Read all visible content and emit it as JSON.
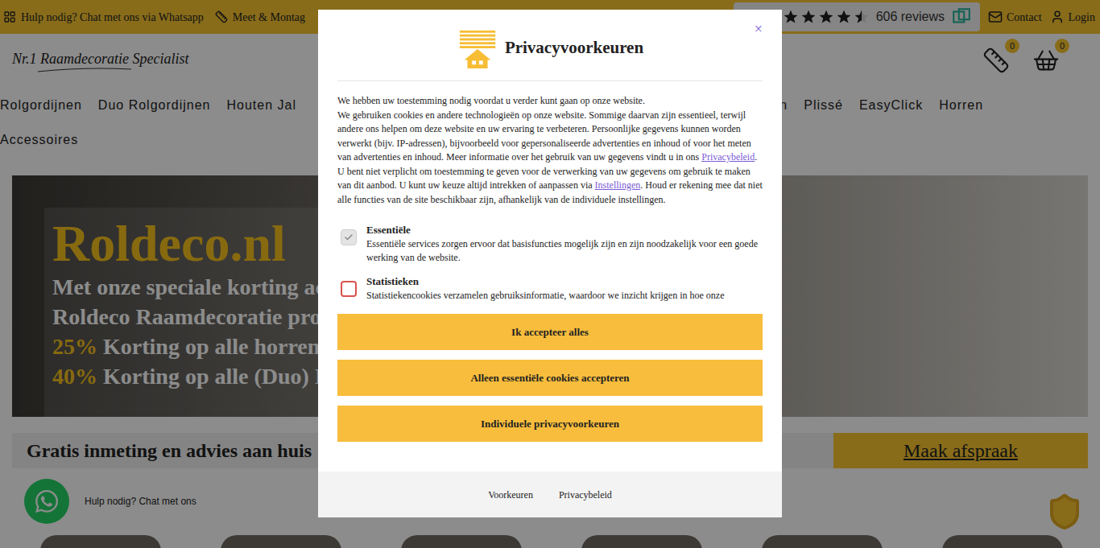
{
  "top_bar": {
    "whatsapp": "Hulp nodig? Chat met ons via Whatsapp",
    "montage": "Meet & Montag",
    "reviews": {
      "stars": 4.5,
      "count": "606 reviews"
    },
    "contact": "Contact",
    "login": "Login"
  },
  "header": {
    "logo": "Nr.1 Raamdecoratie Specialist",
    "compare_count": "0",
    "cart_count": "0"
  },
  "nav": {
    "left": [
      "Rolgordijnen",
      "Duo Rolgordijnen",
      "Houten Jal"
    ],
    "right": [
      "ieën",
      "Plissé",
      "EasyClick",
      "Horren"
    ],
    "second_row": [
      "Accessoires"
    ]
  },
  "hero": {
    "title": "Roldeco.nl",
    "lines": [
      "Met onze speciale korting ac",
      "Roldeco Raamdecoratie prod"
    ],
    "offers": [
      {
        "percent": "25%",
        "text": "Korting op alle horren!"
      },
      {
        "percent": "40%",
        "text": "Korting op alle (Duo) R"
      }
    ]
  },
  "appointment": {
    "text": "Gratis inmeting en advies aan huis",
    "button": "Maak afspraak"
  },
  "whatsapp_widget": {
    "label": "Hulp nodig? Chat met ons"
  },
  "modal": {
    "title": "Privacyvoorkeuren",
    "close": "×",
    "intro": "We hebben uw toestemming nodig voordat u verder kunt gaan op onze website.",
    "body": [
      {
        "text": "We gebruiken cookies en andere technologieën op onze website. Sommige daarvan zijn essentieel, terwijl andere ons helpen om deze website en uw ervaring te verbeteren. Persoonlijke gegevens kunnen worden verwerkt (bijv. IP-adressen), bijvoorbeeld voor gepersonaliseerde advertenties en inhoud of voor het meten van advertenties en inhoud. Meer informatie over het gebruik van uw gegevens vindt u in ons ",
        "link": false
      },
      {
        "text": "Privacybeleid",
        "link": true
      },
      {
        "text": ". U bent niet verplicht om toestemming te geven voor de verwerking van uw gegevens om gebruik te maken van dit aanbod. U kunt uw keuze altijd intrekken of aanpassen via ",
        "link": false
      },
      {
        "text": "Instellingen",
        "link": true
      },
      {
        "text": ". Houd er rekening mee dat niet alle functies van de site beschikbaar zijn, afhankelijk van de individuele instellingen.",
        "link": false
      }
    ],
    "preferences": [
      {
        "label": "Essentiële",
        "description": "Essentiële services zorgen ervoor dat basisfuncties mogelijk zijn en zijn noodzakelijk voor een goede werking van de website.",
        "checked": true,
        "disabled": true
      },
      {
        "label": "Statistieken",
        "description": "Statistiekencookies verzamelen gebruiksinformatie, waardoor we inzicht krijgen in hoe onze",
        "checked": false,
        "disabled": false
      }
    ],
    "buttons": [
      "Ik accepteer alles",
      "Alleen essentiële cookies accepteren",
      "Individuele privacyvoorkeuren"
    ],
    "footer_links": [
      "Voorkeuren",
      "Privacybeleid"
    ]
  }
}
